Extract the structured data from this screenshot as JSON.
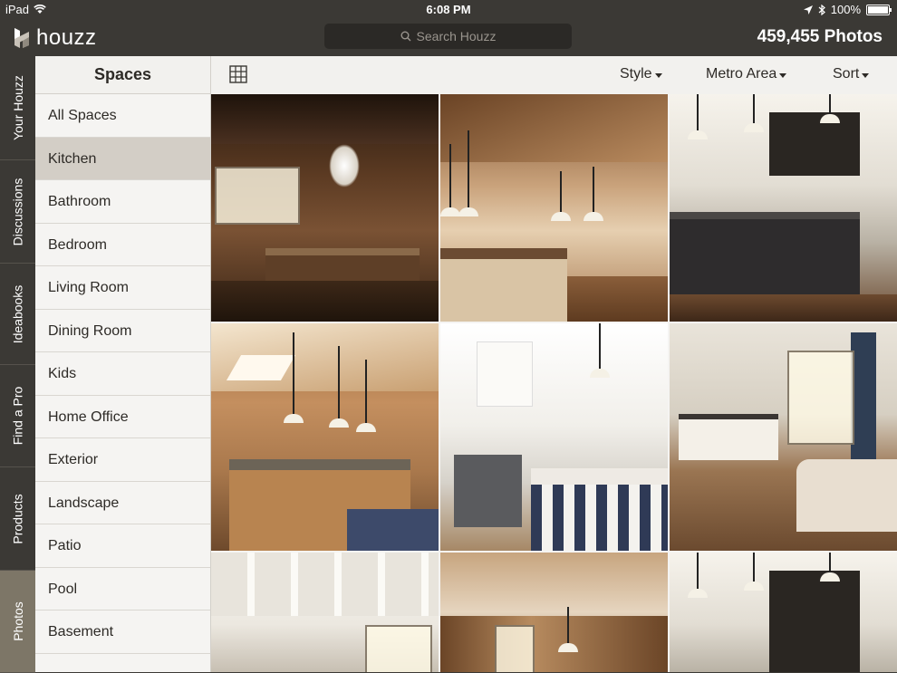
{
  "status_bar": {
    "device": "iPad",
    "time": "6:08 PM",
    "battery": "100%"
  },
  "app": {
    "logo_text": "houzz",
    "search_placeholder": "Search Houzz",
    "photo_count": "459,455 Photos"
  },
  "side_tabs": [
    {
      "label": "Your Houzz",
      "active": false
    },
    {
      "label": "Discussions",
      "active": false
    },
    {
      "label": "Ideabooks",
      "active": false
    },
    {
      "label": "Find a Pro",
      "active": false
    },
    {
      "label": "Products",
      "active": false
    },
    {
      "label": "Photos",
      "active": true
    }
  ],
  "spaces": {
    "title": "Spaces",
    "items": [
      {
        "label": "All Spaces",
        "active": false
      },
      {
        "label": "Kitchen",
        "active": true
      },
      {
        "label": "Bathroom",
        "active": false
      },
      {
        "label": "Bedroom",
        "active": false
      },
      {
        "label": "Living Room",
        "active": false
      },
      {
        "label": "Dining Room",
        "active": false
      },
      {
        "label": "Kids",
        "active": false
      },
      {
        "label": "Home Office",
        "active": false
      },
      {
        "label": "Exterior",
        "active": false
      },
      {
        "label": "Landscape",
        "active": false
      },
      {
        "label": "Patio",
        "active": false
      },
      {
        "label": "Pool",
        "active": false
      },
      {
        "label": "Basement",
        "active": false
      }
    ]
  },
  "toolbar": {
    "style_label": "Style",
    "metro_label": "Metro Area",
    "sort_label": "Sort"
  },
  "colors": {
    "chrome": "#3b3935",
    "active_tab": "#7d7667",
    "active_space": "#d3cec6"
  },
  "photos": [
    {
      "name": "kitchen-photo-1",
      "tone": "dark-wood"
    },
    {
      "name": "kitchen-photo-2",
      "tone": "warm-light"
    },
    {
      "name": "kitchen-photo-3",
      "tone": "white-dark-island"
    },
    {
      "name": "kitchen-photo-4",
      "tone": "warm-wood"
    },
    {
      "name": "kitchen-photo-5",
      "tone": "white-bright"
    },
    {
      "name": "kitchen-photo-6",
      "tone": "open-plan"
    },
    {
      "name": "kitchen-photo-7",
      "tone": "white-ceiling"
    },
    {
      "name": "kitchen-photo-8",
      "tone": "warm-ceiling"
    },
    {
      "name": "kitchen-photo-9",
      "tone": "white-dark-island"
    }
  ]
}
